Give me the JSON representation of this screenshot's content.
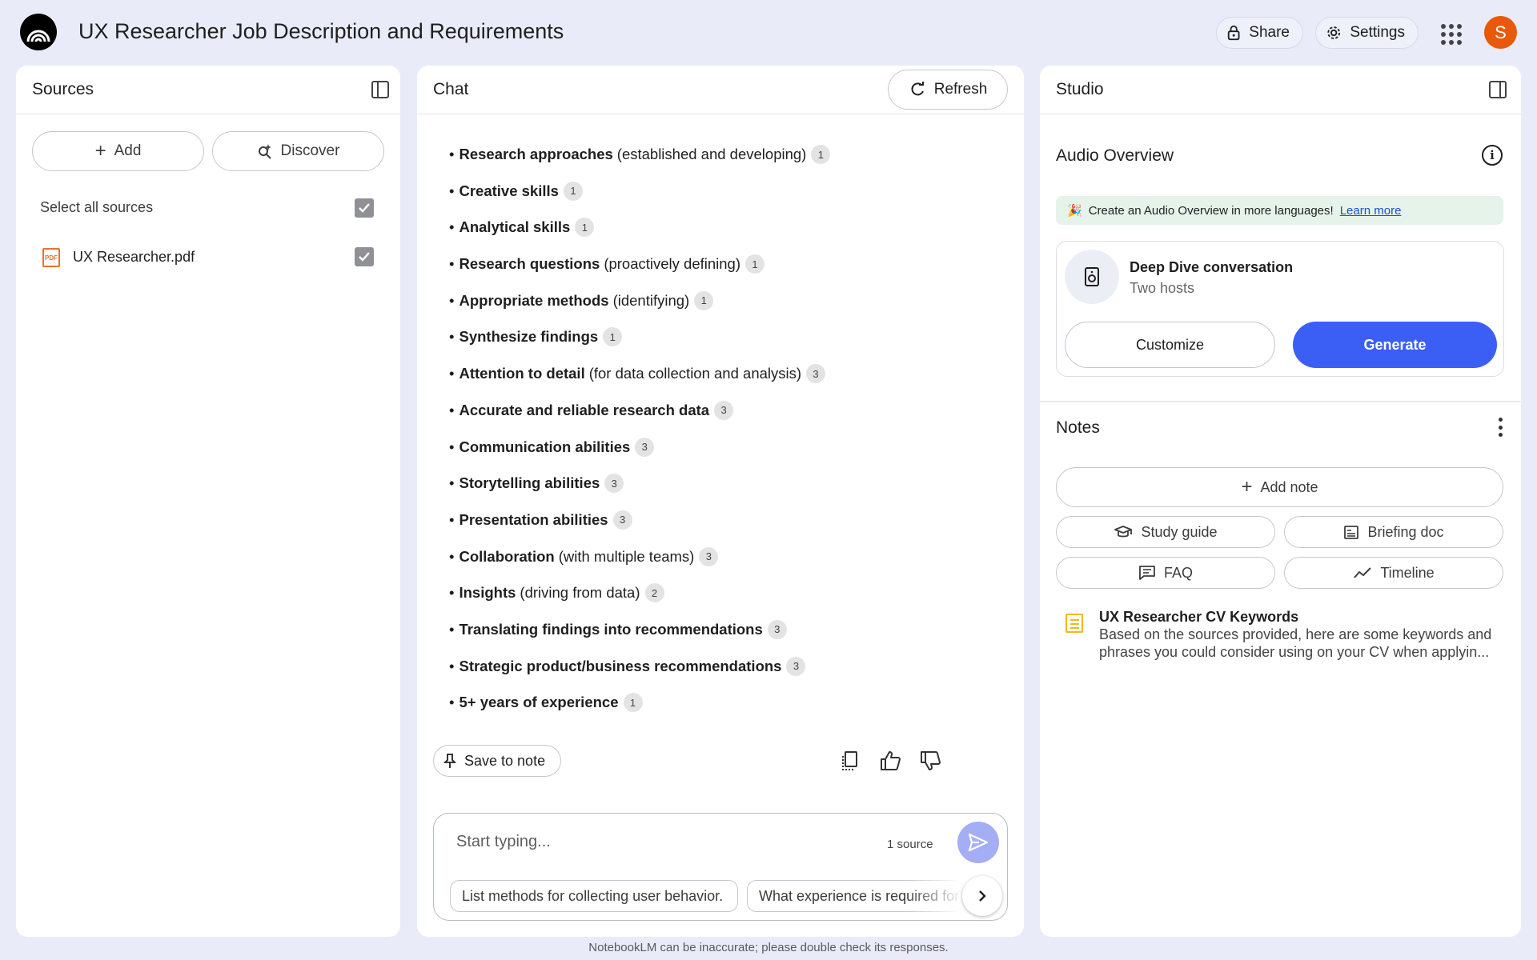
{
  "header": {
    "title": "UX Researcher Job Description and Requirements",
    "share_label": "Share",
    "settings_label": "Settings",
    "avatar_initial": "S",
    "avatar_color": "#e8590c"
  },
  "sources": {
    "title": "Sources",
    "add_label": "Add",
    "discover_label": "Discover",
    "select_all_label": "Select all sources",
    "select_all_checked": true,
    "files": [
      {
        "name": "UX Researcher.pdf",
        "checked": true,
        "icon": "pdf-icon"
      }
    ]
  },
  "chat": {
    "title": "Chat",
    "refresh_label": "Refresh",
    "bullets": [
      {
        "bold": "Research approaches",
        "rest": "(established and developing)",
        "cite": "1"
      },
      {
        "bold": "Creative skills",
        "rest": "",
        "cite": "1"
      },
      {
        "bold": "Analytical skills",
        "rest": "",
        "cite": "1"
      },
      {
        "bold": "Research questions",
        "rest": "(proactively defining)",
        "cite": "1"
      },
      {
        "bold": "Appropriate methods",
        "rest": "(identifying)",
        "cite": "1"
      },
      {
        "bold": "Synthesize findings",
        "rest": "",
        "cite": "1"
      },
      {
        "bold": "Attention to detail",
        "rest": "(for data collection and analysis)",
        "cite": "3"
      },
      {
        "bold": "Accurate and reliable research data",
        "rest": "",
        "cite": "3"
      },
      {
        "bold": "Communication abilities",
        "rest": "",
        "cite": "3"
      },
      {
        "bold": "Storytelling abilities",
        "rest": "",
        "cite": "3"
      },
      {
        "bold": "Presentation abilities",
        "rest": "",
        "cite": "3"
      },
      {
        "bold": "Collaboration",
        "rest": "(with multiple teams)",
        "cite": "3"
      },
      {
        "bold": "Insights",
        "rest": "(driving from data)",
        "cite": "2"
      },
      {
        "bold": "Translating findings into recommendations",
        "rest": "",
        "cite": "3"
      },
      {
        "bold": "Strategic product/business recommendations",
        "rest": "",
        "cite": "3"
      },
      {
        "bold": "5+ years of experience",
        "rest": "",
        "cite": "1"
      }
    ],
    "save_to_note_label": "Save to note",
    "input_placeholder": "Start typing...",
    "source_count": "1 source",
    "suggestions": [
      "List methods for collecting user behavior.",
      "What experience is required for"
    ]
  },
  "studio": {
    "title": "Studio",
    "audio_overview_title": "Audio Overview",
    "banner_emoji": "🎉",
    "banner_text": "Create an Audio Overview in more languages!",
    "banner_link": "Learn more",
    "deep_dive_title": "Deep Dive conversation",
    "deep_dive_subtitle": "Two hosts",
    "customize_label": "Customize",
    "generate_label": "Generate",
    "notes_title": "Notes",
    "add_note_label": "Add note",
    "note_buttons": {
      "study_guide": "Study guide",
      "briefing_doc": "Briefing doc",
      "faq": "FAQ",
      "timeline": "Timeline"
    },
    "saved_note": {
      "title": "UX Researcher CV Keywords",
      "snippet": "Based on the sources provided, here are some keywords and phrases you could consider using on your CV when applyin..."
    }
  },
  "footer": "NotebookLM can be inaccurate; please double check its responses.",
  "colors": {
    "page_bg": "#e9ecf8",
    "accent": "#3b5ff5",
    "send_button": "#a3aef5",
    "banner_bg": "#e5f3ea"
  }
}
